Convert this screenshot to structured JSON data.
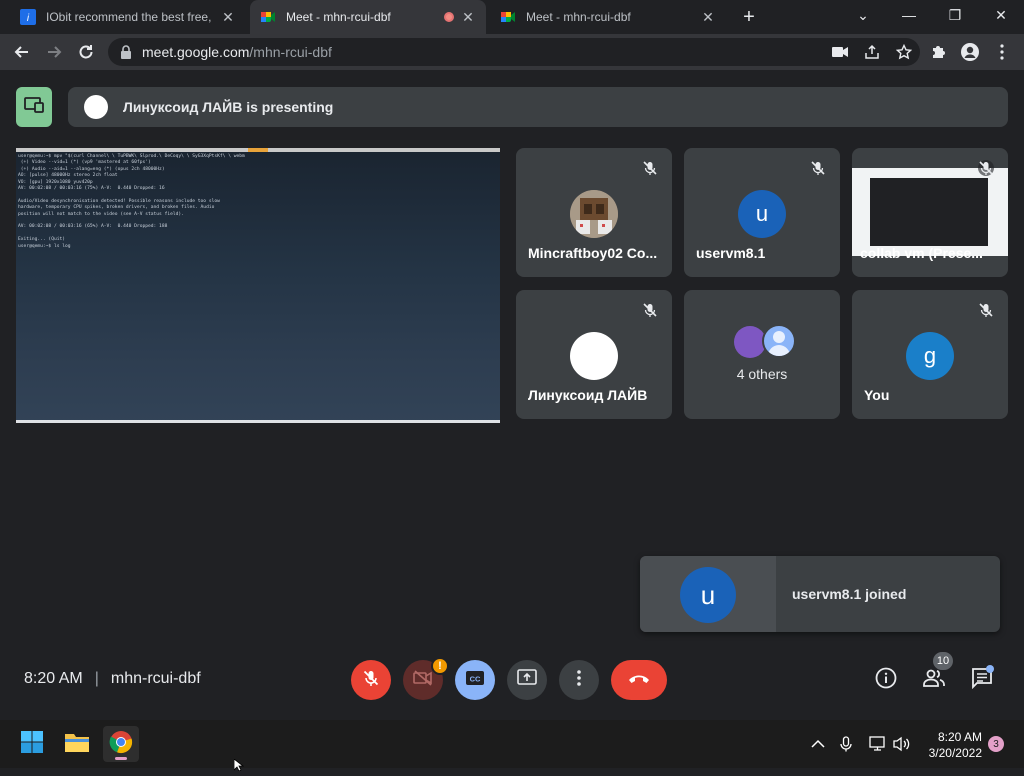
{
  "browser": {
    "tabs": [
      {
        "title": "IObit recommend the best free, f",
        "icon": "iobit-icon",
        "active": false
      },
      {
        "title": "Meet - mhn-rcui-dbf",
        "icon": "google-meet-icon",
        "active": true,
        "recording": true
      },
      {
        "title": "Meet - mhn-rcui-dbf",
        "icon": "google-meet-icon",
        "active": false
      }
    ],
    "new_tab_label": "+",
    "url_host": "meet.google.com",
    "url_path": "/mhn-rcui-dbf"
  },
  "meet": {
    "presenting_text": "Линуксоид ЛАЙВ is presenting",
    "presentation_terminal": [
      "user@qemu:~$ mpv \"$(curl Channel\\ \\ TuPBWK\\ Slprod.\\ DeCoqy\\ \\ SyG3XqPtsKf\\ \\ webm",
      " (+) Video --vid=1 (*) (vp9 'mastered at 60fps')",
      " (+) Audio --aid=1 --alang=eng (*) (opus 2ch 48000Hz)",
      "AO: [pulse] 48000Hz stereo 2ch float",
      "VO: [gpu] 1920x1080 yuv420p",
      "AV: 00:02:08 / 00:03:16 (75%) A-V:  0.440 Dropped: 16",
      "",
      "Audio/Video desynchronisation detected! Possible reasons include too slow",
      "hardware, temporary CPU spikes, broken drivers, and broken files. Audio",
      "position will not match to the video (see A-V status field).",
      "",
      "AV: 00:02:08 / 00:03:16 (65%) A-V:  0.440 Dropped: 188",
      "",
      "Exiting... (Quit)",
      "user@qemu:~$ ls log"
    ],
    "tiles": [
      {
        "name": "Mincraftboy02 Co...",
        "avatar": "minecraft-avatar",
        "muted": true
      },
      {
        "name": "uservm8.1",
        "avatar_letter": "u",
        "avatar_color": "#1a62b8",
        "muted": true
      },
      {
        "name": "collab vm (Prese...",
        "avatar": "screen-share-thumbnail",
        "muted": true
      },
      {
        "name": "Линуксоид ЛАЙВ",
        "avatar_color": "#ffffff",
        "muted": true
      },
      {
        "name": "4 others",
        "avatar": "others-avatars",
        "muted": false
      },
      {
        "name": "You",
        "avatar_letter": "g",
        "avatar_color": "#1a7fc9",
        "muted": true
      }
    ],
    "toast": {
      "avatar_letter": "u",
      "message": "uservm8.1 joined"
    },
    "controls": {
      "time": "8:20 AM",
      "separator": "|",
      "meeting_code": "mhn-rcui-dbf",
      "camera_warning": "!",
      "people_count": "10"
    }
  },
  "taskbar": {
    "clock_time": "8:20 AM",
    "clock_date": "3/20/2022",
    "notification_count": "3"
  },
  "colors": {
    "meet_bg": "#202124",
    "tile_bg": "#3c4043",
    "danger": "#ea4335",
    "accent_blue": "#8ab4f8",
    "present_green": "#81c995"
  }
}
